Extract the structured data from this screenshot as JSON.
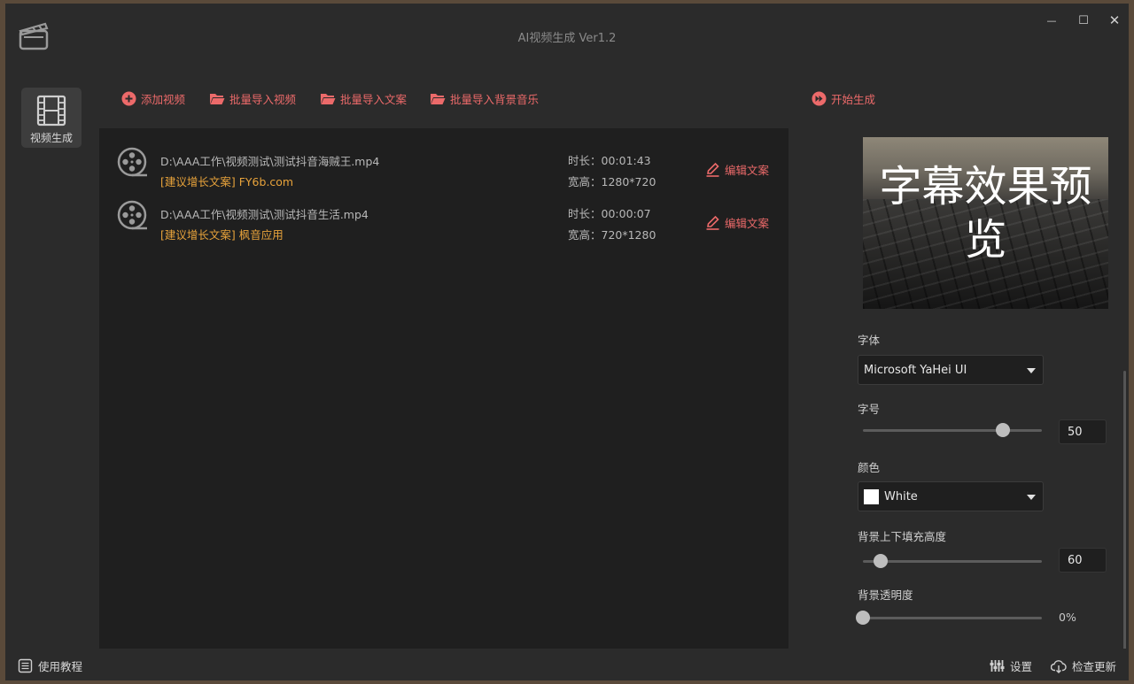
{
  "window": {
    "title": "AI视频生成 Ver1.2",
    "controls": {
      "minimize": "—",
      "maximize": "☐",
      "close": "✕"
    }
  },
  "sidebar": {
    "items": [
      {
        "label": "视频生成",
        "icon": "film-icon",
        "active": true
      }
    ]
  },
  "toolbar": {
    "add_video": "添加视频",
    "import_videos": "批量导入视频",
    "import_scripts": "批量导入文案",
    "import_music": "批量导入背景音乐",
    "start": "开始生成",
    "accent": "#ec6a6a"
  },
  "videos": [
    {
      "path": "D:\\AAA工作\\视频测试\\测试抖音海贼王.mp4",
      "tip": "[建议增长文案] FY6b.com",
      "duration": "时长：00:01:43",
      "size": "宽高：1280*720",
      "edit_label": "编辑文案"
    },
    {
      "path": "D:\\AAA工作\\视频测试\\测试抖音生活.mp4",
      "tip": "[建议增长文案] 枫音应用",
      "duration": "时长：00:00:07",
      "size": "宽高：720*1280",
      "edit_label": "编辑文案"
    }
  ],
  "settings": {
    "preview_text": "字幕效果预览",
    "font_label": "字体",
    "font_value": "Microsoft YaHei UI",
    "size_label": "字号",
    "size_value": "50",
    "size_fraction": 0.78,
    "color_label": "颜色",
    "color_value": "White",
    "color_hex": "#ffffff",
    "padding_label": "背景上下填充高度",
    "padding_value": "60",
    "padding_fraction": 0.1,
    "opacity_label": "背景透明度",
    "opacity_value": "0%",
    "opacity_fraction": 0.0
  },
  "statusbar": {
    "tutorial": "使用教程",
    "settings": "设置",
    "update": "检查更新"
  }
}
